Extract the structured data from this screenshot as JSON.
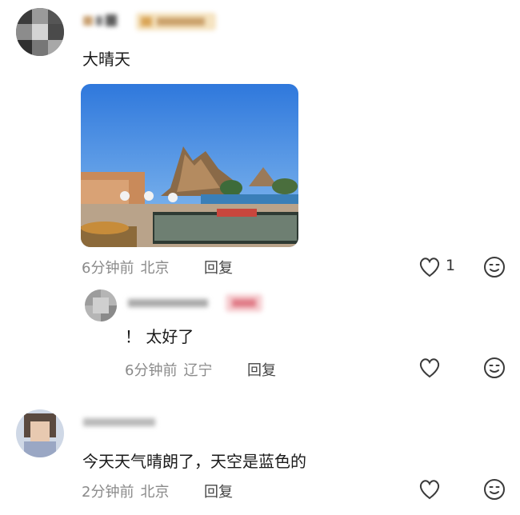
{
  "comments": [
    {
      "text": "大晴天",
      "time": "6分钟前",
      "location": "北京",
      "reply_label": "回复",
      "like_count": "1",
      "reply": {
        "text": "！ 太好了",
        "time": "6分钟前",
        "location": "辽宁",
        "reply_label": "回复"
      }
    },
    {
      "text": "今天天气晴朗了，天空是蓝色的",
      "time": "2分钟前",
      "location": "北京",
      "reply_label": "回复"
    }
  ],
  "icons": {
    "like": "heart-outline",
    "emoji": "smiley-face"
  },
  "colors": {
    "meta_text": "#8a8a8a",
    "sky": "#4a8fe0",
    "icon_stroke": "#3a3a3a"
  }
}
